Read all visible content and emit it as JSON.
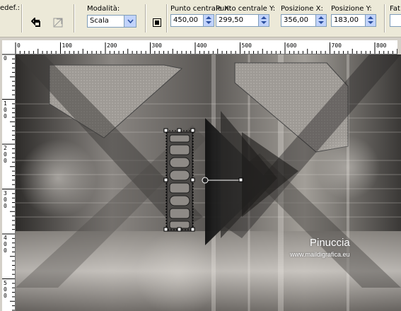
{
  "toolbar": {
    "preset_label": "edef.:",
    "mode_label": "Modalità:",
    "mode_value": "Scala",
    "center_x_label": "Punto centrale X:",
    "center_x_value": "450,00",
    "center_y_label": "Punto centrale Y:",
    "center_y_value": "299,50",
    "pos_x_label": "Posizione X:",
    "pos_x_value": "356,00",
    "pos_y_label": "Posizione Y:",
    "pos_y_value": "183,00",
    "factor_label": "Fat"
  },
  "rulers": {
    "top_ticks": [
      "0",
      "100",
      "200",
      "300",
      "400",
      "500",
      "600",
      "700",
      "800"
    ],
    "left_ticks": [
      "0",
      "1\n0\n0",
      "2\n0\n0",
      "3\n0\n0",
      "4\n0\n0",
      "5\n0\n0"
    ]
  },
  "canvas": {
    "watermark_name": "Pinuccia",
    "watermark_url": "www.maildigrafica.eu"
  },
  "icons": {
    "reset": "reset-rotation-icon",
    "apply": "apply-transform-icon",
    "transform": "transform-icon"
  }
}
